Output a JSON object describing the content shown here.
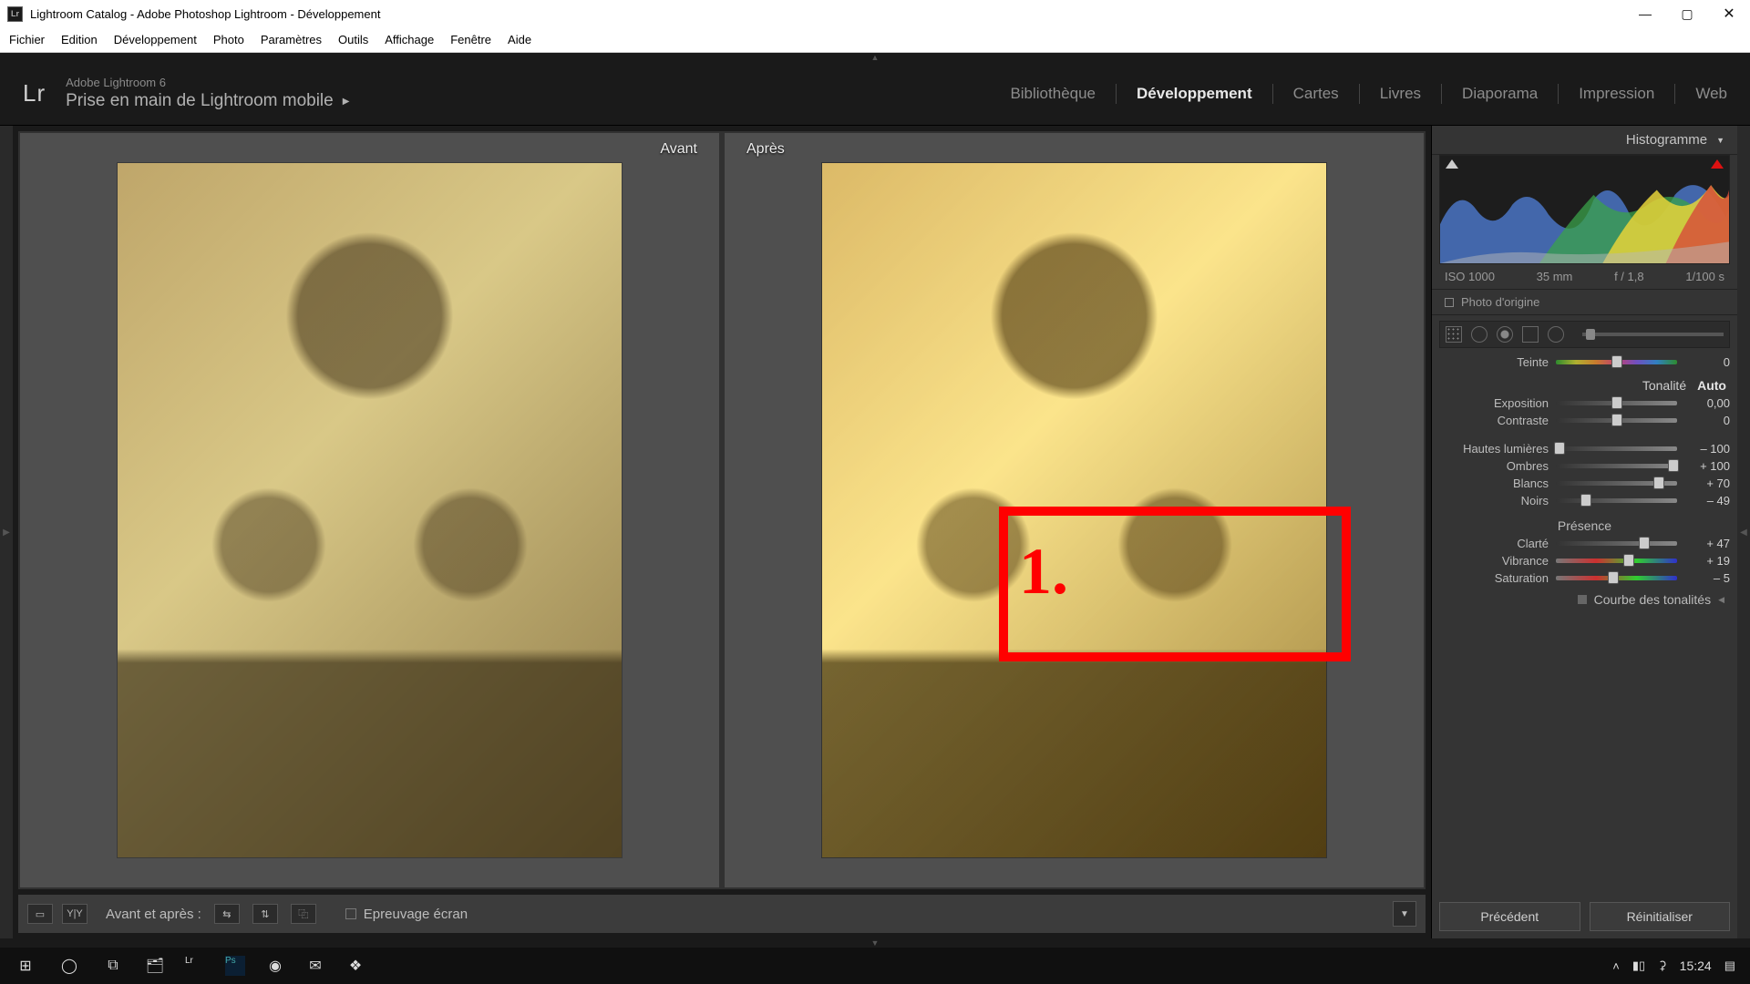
{
  "window": {
    "title": "Lightroom Catalog - Adobe Photoshop Lightroom - Développement"
  },
  "menus": [
    "Fichier",
    "Edition",
    "Développement",
    "Photo",
    "Paramètres",
    "Outils",
    "Affichage",
    "Fenêtre",
    "Aide"
  ],
  "identity": {
    "product": "Adobe Lightroom 6",
    "subtitle": "Prise en main de Lightroom mobile"
  },
  "modules": [
    "Bibliothèque",
    "Développement",
    "Cartes",
    "Livres",
    "Diaporama",
    "Impression",
    "Web"
  ],
  "active_module": "Développement",
  "compare": {
    "before": "Avant",
    "after": "Après"
  },
  "bottom": {
    "mode_label": "Avant et après :",
    "proofing": "Epreuvage écran"
  },
  "right": {
    "histogram_label": "Histogramme",
    "meta": {
      "iso": "ISO 1000",
      "focal": "35 mm",
      "aperture": "f / 1,8",
      "shutter": "1/100 s"
    },
    "origin": "Photo d'origine",
    "teinte": {
      "label": "Teinte",
      "value": "0",
      "pos": 50
    },
    "tonalite": {
      "label": "Tonalité",
      "auto": "Auto"
    },
    "exposition": {
      "label": "Exposition",
      "value": "0,00",
      "pos": 50
    },
    "contraste": {
      "label": "Contraste",
      "value": "0",
      "pos": 50
    },
    "hautes": {
      "label": "Hautes lumières",
      "value": "– 100",
      "pos": 3
    },
    "ombres": {
      "label": "Ombres",
      "value": "+ 100",
      "pos": 97
    },
    "blancs": {
      "label": "Blancs",
      "value": "+ 70",
      "pos": 85
    },
    "noirs": {
      "label": "Noirs",
      "value": "– 49",
      "pos": 25
    },
    "presence_label": "Présence",
    "clarte": {
      "label": "Clarté",
      "value": "+ 47",
      "pos": 73
    },
    "vibrance": {
      "label": "Vibrance",
      "value": "+ 19",
      "pos": 60
    },
    "saturation": {
      "label": "Saturation",
      "value": "– 5",
      "pos": 47
    },
    "curves": "Courbe des tonalités",
    "prev_btn": "Précédent",
    "reset_btn": "Réinitialiser"
  },
  "annotation": {
    "label": "1."
  },
  "taskbar": {
    "clock": "15:24"
  }
}
